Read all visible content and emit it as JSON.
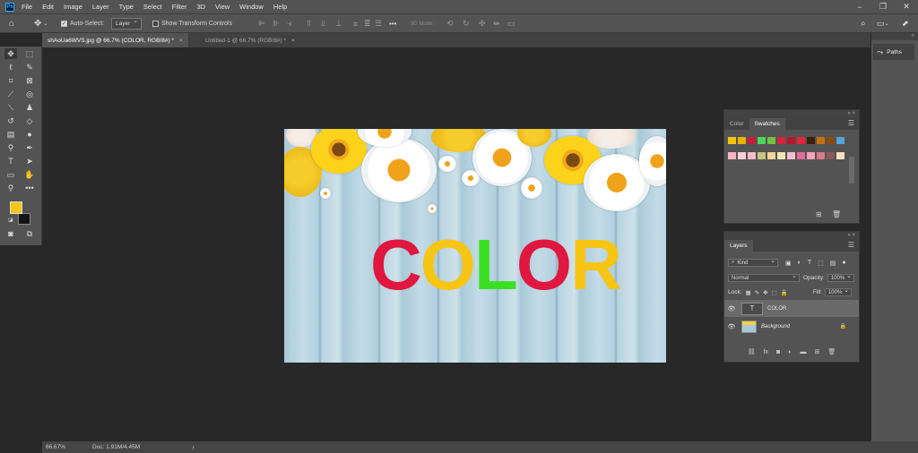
{
  "menu": {
    "logo": "Ps",
    "items": [
      "File",
      "Edit",
      "Image",
      "Layer",
      "Type",
      "Select",
      "Filter",
      "3D",
      "View",
      "Window",
      "Help"
    ],
    "window_controls": [
      "−",
      "❐",
      "✕"
    ]
  },
  "options": {
    "auto_select_label": "Auto-Select:",
    "auto_select_value": "Layer",
    "show_transform_label": "Show Transform Controls",
    "more": "•••",
    "mode_3d_label": "3D Mode:"
  },
  "tabs": [
    {
      "label": "shAoUa6WVS.jpg @ 66.7% (COLOR, RGB/8#) *",
      "close": "×"
    },
    {
      "label": "Untitled-1 @ 66.7% (RGB/8#) *",
      "close": "×"
    }
  ],
  "right_panel": {
    "paths_label": "Paths"
  },
  "canvas": {
    "word": [
      {
        "ch": "C",
        "color": "#e0173f"
      },
      {
        "ch": "O",
        "color": "#f7c514"
      },
      {
        "ch": "L",
        "color": "#3be022"
      },
      {
        "ch": "O",
        "color": "#e0173f"
      },
      {
        "ch": "R",
        "color": "#f7c514"
      }
    ]
  },
  "colors": {
    "foreground": "#f7c514",
    "background": "#141414"
  },
  "swatches_panel": {
    "tabs": [
      "Color",
      "Swatches"
    ],
    "active_tab": "Swatches",
    "row1": [
      "#f4c20d",
      "#e7b200",
      "#c81e3e",
      "#4cd45a",
      "#6ec046",
      "#d2263a",
      "#b5182e",
      "#e8223a",
      "#3b1f0f",
      "#c46e12",
      "#8a4a16",
      "#52a3d8"
    ],
    "row2": [
      "#f6b7c4",
      "#f8cfd8",
      "#f2bdc9",
      "#c4c483",
      "#f6d39a",
      "#f2e5b3",
      "#f5c0cf",
      "#e26b9a",
      "#f2a4bc",
      "#d67a8e",
      "#8a5a5a",
      "#f8e0c0"
    ]
  },
  "layers_panel": {
    "tab": "Layers",
    "kind_label": "Kind",
    "blend_mode": "Normal",
    "opacity_label": "Opacity:",
    "opacity_value": "100%",
    "lock_label": "Lock:",
    "fill_label": "Fill:",
    "fill_value": "100%",
    "layers": [
      {
        "name": "COLOR",
        "type": "text",
        "selected": true
      },
      {
        "name": "Background",
        "type": "image",
        "locked": true
      }
    ],
    "footer_icons": [
      "link-icon",
      "fx-icon",
      "mask-icon",
      "adjustment-icon",
      "folder-icon",
      "new-layer-icon",
      "trash-icon"
    ]
  },
  "status": {
    "zoom": "66.67%",
    "doc": "Doc: 1.91M/4.45M",
    "arrow": "›"
  }
}
